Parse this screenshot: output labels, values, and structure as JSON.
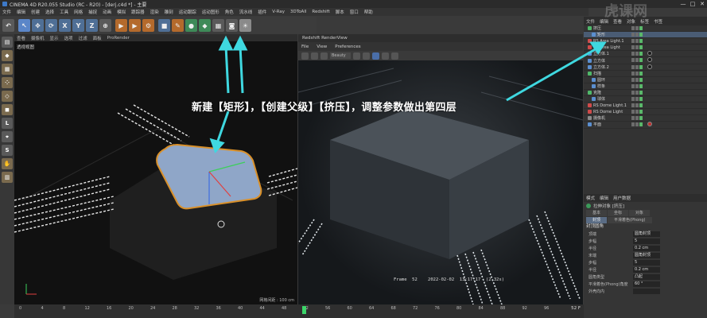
{
  "window": {
    "title": "CINEMA 4D R20.055 Studio (RC - R20) - [derj.c4d *] - 主要",
    "controls": [
      "—",
      "□",
      "✕"
    ]
  },
  "menubar": {
    "items": [
      "文件",
      "编辑",
      "创建",
      "选择",
      "工具",
      "网格",
      "捕捉",
      "动画",
      "模拟",
      "跟踪器",
      "渲染",
      "雕刻",
      "运动跟踪",
      "运动图形",
      "角色",
      "流水线",
      "插件",
      "V-Ray",
      "3DToAll",
      "Redshift",
      "脚本",
      "窗口",
      "帮助"
    ]
  },
  "toolbar": {
    "undo_icon": "undo-icon",
    "buttons": [
      "↖",
      "✥",
      "⟳",
      "X",
      "Y",
      "Z",
      "⊕"
    ]
  },
  "viewport": {
    "menu": [
      "查看",
      "摄像机",
      "显示",
      "选项",
      "过滤",
      "面板",
      "ProRender"
    ],
    "label": "透视视图",
    "grid_scale": "网格间距 : 100 cm"
  },
  "render_view": {
    "title": "Redshift RenderView",
    "menu": [
      "File",
      "View",
      "Preferences"
    ],
    "preset": "Beauty",
    "status": "Frame  52    2022-02-02  13:17:17  (2.32s)"
  },
  "object_manager": {
    "tabs": [
      "文件",
      "编辑",
      "查看",
      "对象",
      "标签",
      "书签"
    ],
    "rows": [
      {
        "name": "挤压",
        "color": "#4fb86a",
        "indent": 1,
        "tag": ""
      },
      {
        "name": "矩形",
        "color": "#5b8fd0",
        "indent": 2,
        "tag": "",
        "highlight": true
      },
      {
        "name": "RS Area Light.1",
        "color": "#d04a4a",
        "indent": 1,
        "tag": ""
      },
      {
        "name": "RS Area Light",
        "color": "#d04a4a",
        "indent": 1,
        "tag": ""
      },
      {
        "name": "立方体.1",
        "color": "#5b8fd0",
        "indent": 1,
        "tag": "#1a1a1a"
      },
      {
        "name": "立方体",
        "color": "#5b8fd0",
        "indent": 1,
        "tag": "#1a1a1a"
      },
      {
        "name": "立方体.2",
        "color": "#5b8fd0",
        "indent": 1,
        "tag": "#1a1a1a"
      },
      {
        "name": "扫描",
        "color": "#4fb86a",
        "indent": 1,
        "tag": ""
      },
      {
        "name": "圆环",
        "color": "#5b8fd0",
        "indent": 2,
        "tag": ""
      },
      {
        "name": "样条",
        "color": "#5b8fd0",
        "indent": 2,
        "tag": ""
      },
      {
        "name": "克隆",
        "color": "#4fb86a",
        "indent": 1,
        "tag": ""
      },
      {
        "name": "球体",
        "color": "#5b8fd0",
        "indent": 2,
        "tag": ""
      },
      {
        "name": "RS Dome Light.1",
        "color": "#d04a4a",
        "indent": 1,
        "tag": ""
      },
      {
        "name": "RS Dome Light",
        "color": "#d04a4a",
        "indent": 1,
        "tag": ""
      },
      {
        "name": "摄像机",
        "color": "#8a8a8a",
        "indent": 1,
        "tag": ""
      },
      {
        "name": "平面",
        "color": "#5b8fd0",
        "indent": 1,
        "tag": "#c03030"
      }
    ]
  },
  "attributes": {
    "tabs": [
      "模式",
      "编辑",
      "用户数据"
    ],
    "object": "拉伸对象 [挤压]",
    "sub_tabs": [
      "基本",
      "坐标",
      "对象",
      "封顶",
      "平滑着色(Phong)"
    ],
    "section": "封顶圆角",
    "rows": [
      {
        "label": "顶端",
        "value": "圆角封顶"
      },
      {
        "label": "步幅",
        "value": "5"
      },
      {
        "label": "半径",
        "value": "0.2 cm"
      },
      {
        "label": "末端",
        "value": "圆角封顶"
      },
      {
        "label": "步幅",
        "value": "5"
      },
      {
        "label": "半径",
        "value": "0.2 cm"
      },
      {
        "label": "圆角类型",
        "value": "凸起"
      },
      {
        "label": "平滑着色(Phong)角度",
        "value": "60 °"
      },
      {
        "label": "外壳向内",
        "value": ""
      }
    ]
  },
  "timeline": {
    "ticks": [
      "0",
      "4",
      "8",
      "12",
      "16",
      "20",
      "24",
      "28",
      "32",
      "36",
      "40",
      "44",
      "48",
      "52",
      "56",
      "60",
      "64",
      "68",
      "72",
      "76",
      "80",
      "84",
      "88",
      "92",
      "96"
    ],
    "current_frame": "52",
    "end_label": "52 F"
  },
  "annotation": {
    "text": "新建【矩形】，【创建父级】【挤压】，调整参数做出第四层"
  },
  "watermark": "虎课网"
}
